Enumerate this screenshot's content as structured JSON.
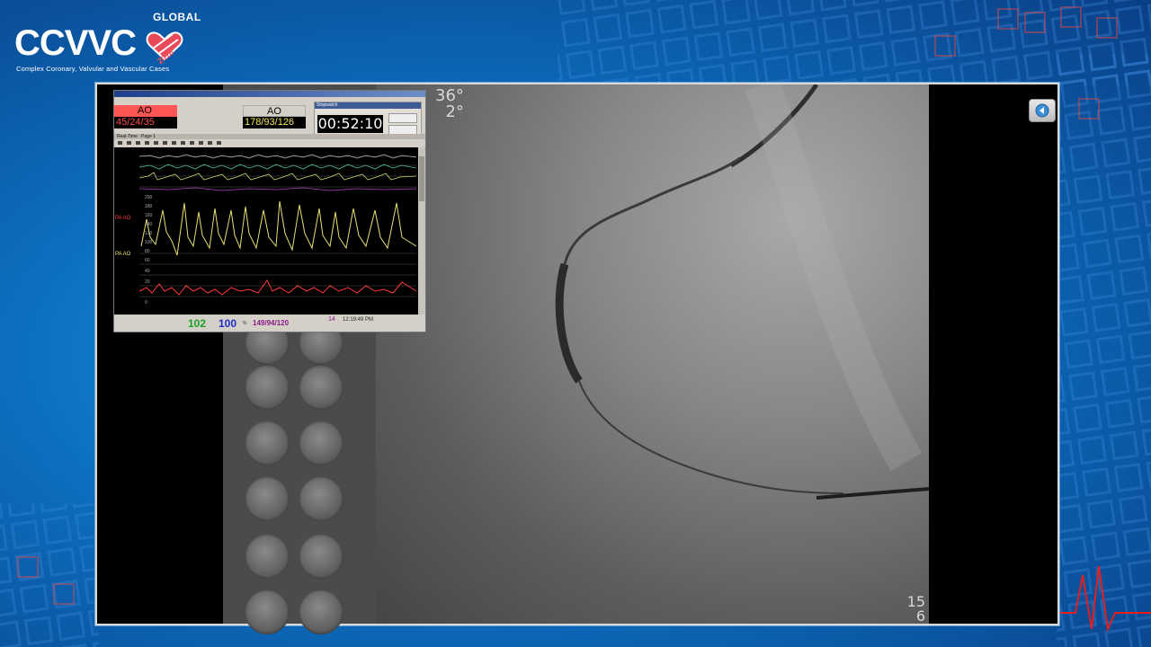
{
  "branding": {
    "global_label": "GLOBAL",
    "logo_text": "CCVVC",
    "year": "2018",
    "subtitle": "Complex Coronary, Valvular and Vascular Cases",
    "accent_color": "#e84a5a"
  },
  "monitor": {
    "left_channel_label": "AO",
    "left_pressure": "45/24/35",
    "right_channel_label": "AO",
    "right_pressure": "178/93/126",
    "stopwatch_value": "00:52:10",
    "stopwatch_title": "Stopwatch",
    "realtime_label": "Real-Time : Page 1",
    "waveform_labels": [
      "PA AO",
      "PA AO"
    ],
    "scale_values": [
      "200",
      "180",
      "160",
      "140",
      "120",
      "100",
      "80",
      "60",
      "40",
      "20",
      "0"
    ],
    "heart_rate": "102",
    "spo2": "100",
    "spo2_unit": "%",
    "nibp": "149/94/120",
    "resp": "14",
    "clock": "12:19:49 PM",
    "colors": {
      "ao_left_bg": "#ff5555",
      "ao_left_value": "#ff4a4a",
      "ao_right_value": "#f1e75a",
      "hr": "#18a028",
      "spo2": "#1c2cc8",
      "nibp": "#8a1a8a",
      "wave_yellow": "#e8e070",
      "wave_red": "#ff3a3a"
    }
  },
  "fluoroscopy": {
    "angle_line1": "36°",
    "angle_line2": "2°",
    "frame_number_line1": "15",
    "frame_number_line2": "6"
  },
  "controls": {
    "collapse_icon": "back-arrow-icon"
  }
}
